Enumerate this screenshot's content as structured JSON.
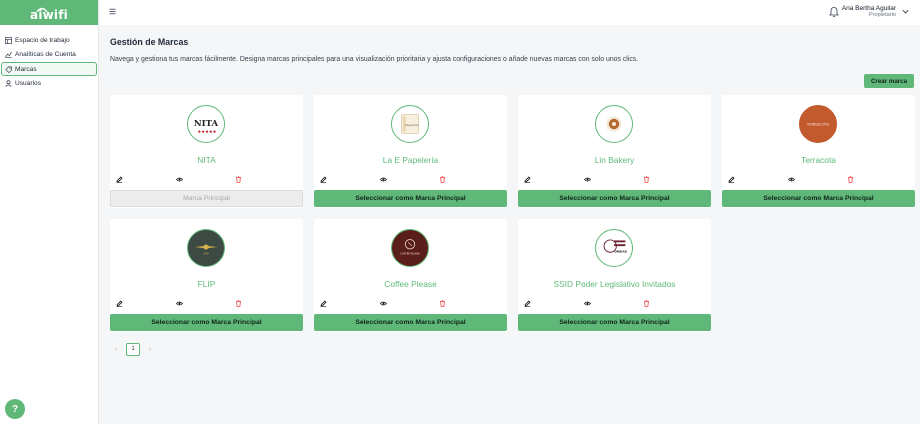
{
  "app": {
    "logo_text": "aiwifi"
  },
  "sidebar": {
    "items": [
      {
        "label": "Espacio de trabajo",
        "icon": "workspace-icon",
        "active": false
      },
      {
        "label": "Analíticas de Cuenta",
        "icon": "analytics-icon",
        "active": false
      },
      {
        "label": "Marcas",
        "icon": "brand-icon",
        "active": true
      },
      {
        "label": "Usuarios",
        "icon": "user-icon",
        "active": false
      }
    ],
    "help_label": "?"
  },
  "topbar": {
    "user_name": "Ana Bertha Aguilar",
    "user_role": "Propietario"
  },
  "main": {
    "title": "Gestión de Marcas",
    "description": "Navega y gestiona tus marcas fácilmente. Designa marcas principales para una visualización prioritaria y ajusta configuraciones o añade nuevas marcas con solo unos clics.",
    "create_button": "Crear marca",
    "brands": [
      {
        "name": "NITA",
        "button": "Marca Principal",
        "is_main": true,
        "logo_text": "NITA"
      },
      {
        "name": "La E Papelería",
        "button": "Seleccionar como Marca Principal",
        "is_main": false,
        "logo_text": "Papelería"
      },
      {
        "name": "Lin Bakery",
        "button": "Seleccionar como Marca Principal",
        "is_main": false,
        "logo_text": ""
      },
      {
        "name": "Terracota",
        "button": "Seleccionar como Marca Principal",
        "is_main": false,
        "logo_text": "TERRACOTA"
      },
      {
        "name": "FLIP",
        "button": "Seleccionar como Marca Principal",
        "is_main": false,
        "logo_text": "FLIP"
      },
      {
        "name": "Coffee Please",
        "button": "Seleccionar como Marca Principal",
        "is_main": false,
        "logo_text": "COFFEE PLEASE"
      },
      {
        "name": "SSID Poder Legislativo Invitados",
        "button": "Seleccionar como Marca Principal",
        "is_main": false,
        "logo_text": "UNIDAD"
      }
    ],
    "pagination": {
      "current_page": "1",
      "prev": "‹",
      "next": "›"
    }
  },
  "colors": {
    "accent": "#5fb878",
    "brand_text": "#5fb878",
    "danger": "#ef4444"
  }
}
